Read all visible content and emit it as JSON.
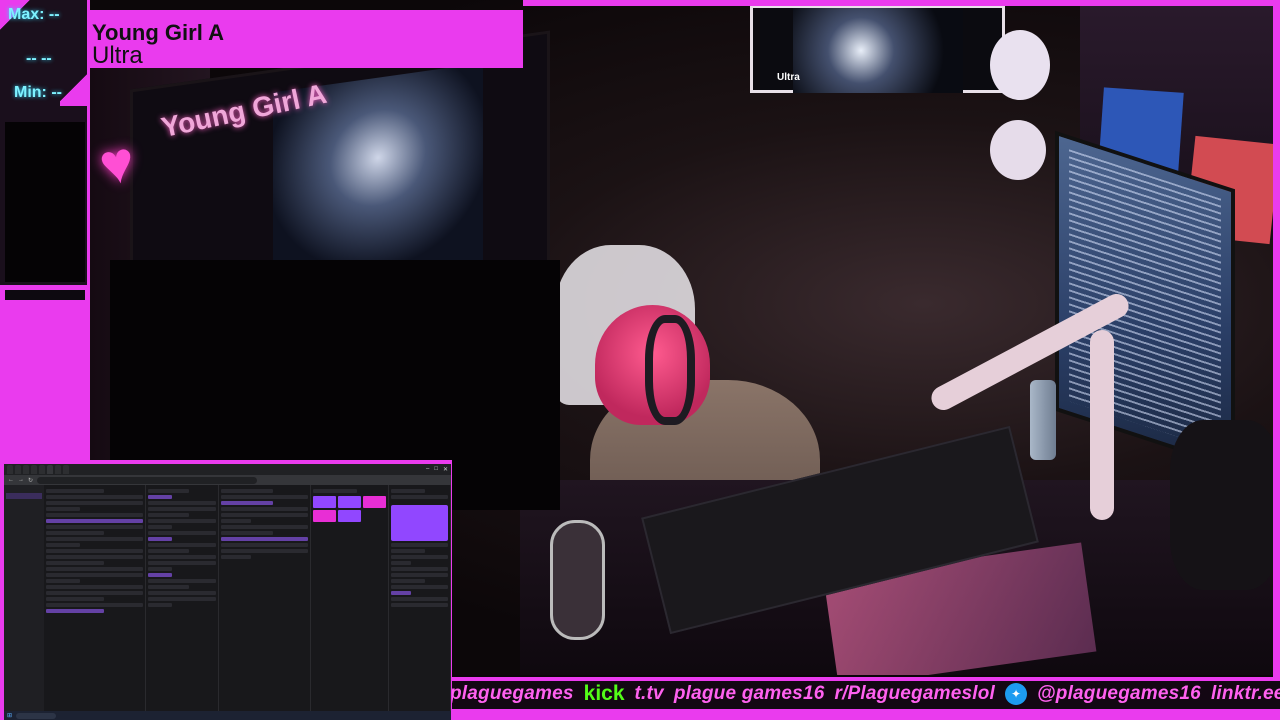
{
  "overlay": {
    "stats": {
      "max": "Max: --",
      "mid": "-- --",
      "min": "Min: --"
    },
    "now_playing": {
      "song": "Young Girl A",
      "artist": "Ultra"
    },
    "scene": {
      "poster_text": "Young Girl A",
      "monitor_label": "Ultra"
    },
    "ticker": {
      "items": [
        "plaguegames",
        "kick",
        "t.tv",
        "plague games16",
        "r/Plaguegameslol",
        "@plaguegames16",
        "linktr.ee/p"
      ]
    },
    "colors": {
      "accent": "#ea3bee",
      "stats_text": "#7ef2ff",
      "kick": "#53fc18",
      "twitter": "#1d9bf0"
    },
    "icons": {
      "heart": "heart-icon",
      "twitter": "twitter-bird-icon"
    }
  }
}
